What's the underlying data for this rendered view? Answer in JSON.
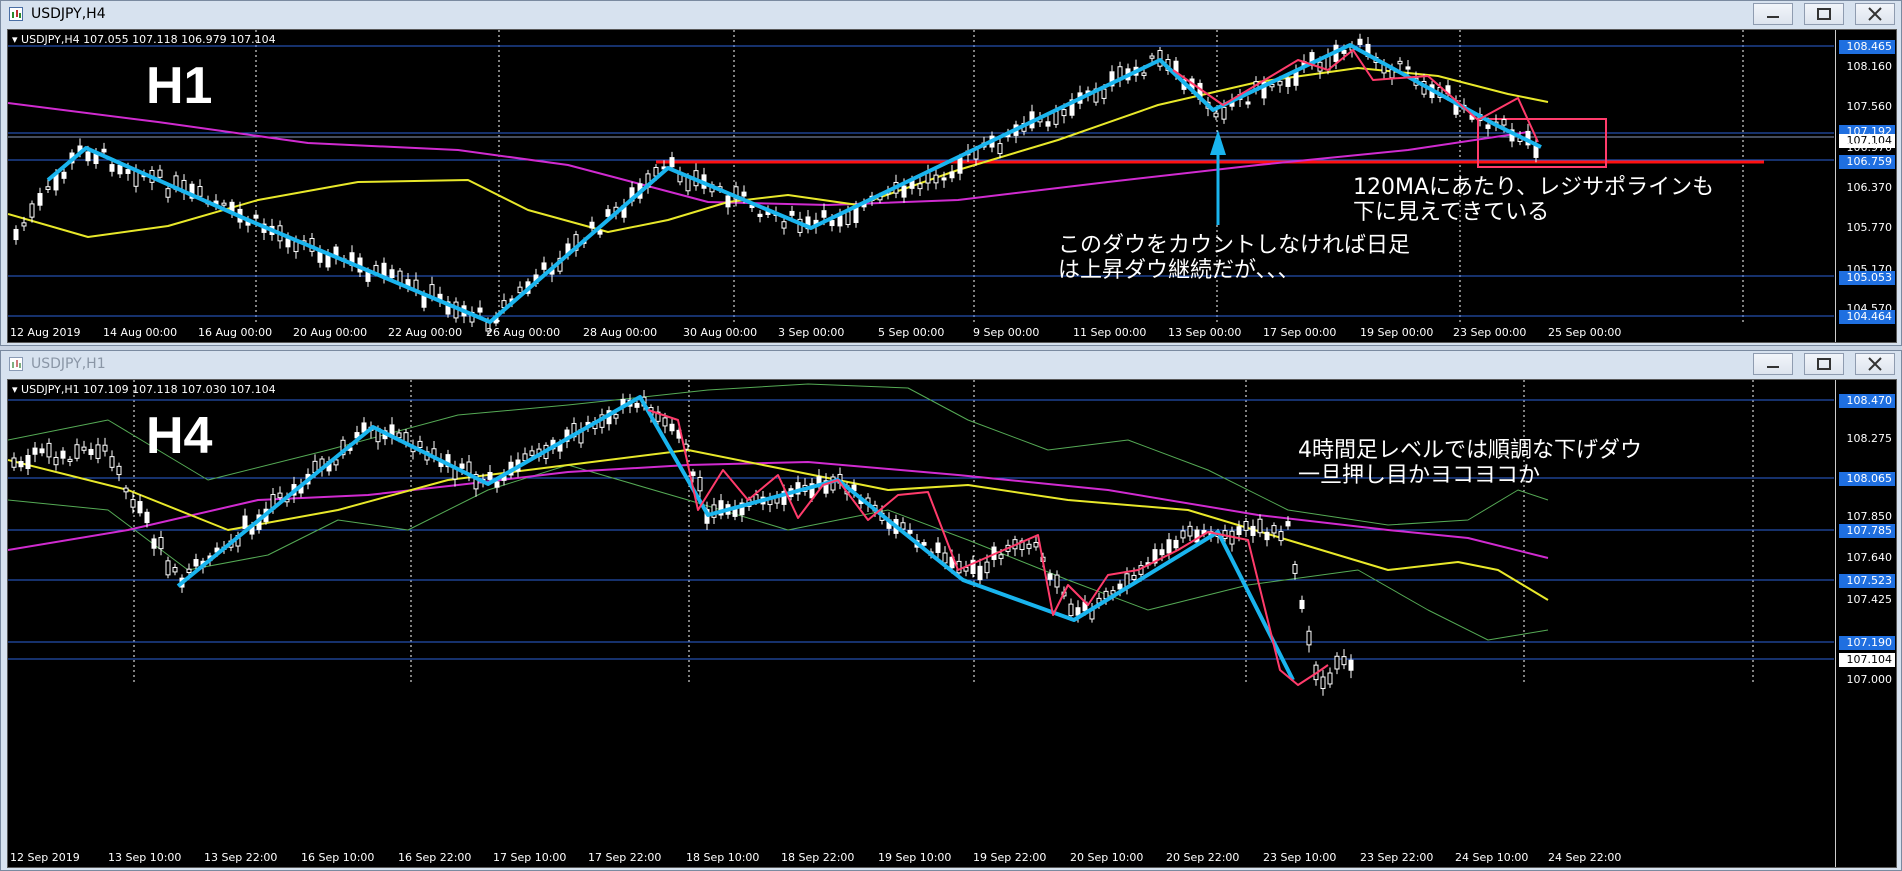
{
  "top_window": {
    "title": "USDJPY,H4",
    "header": "USDJPY,H4  107.055 107.118 106.979 107.104",
    "big_label": "H1",
    "annotation_right": "120MAにあたり、レジサポラインも\n下に見えてきている",
    "annotation_center": "このダウをカウントしなければ日足\nは上昇ダウ継続だが、、、",
    "price_ticks": [
      "108.160",
      "107.560",
      "106.970",
      "106.370",
      "105.770",
      "105.170",
      "104.570"
    ],
    "price_tags": [
      {
        "label": "108.465",
        "bg": "#1f6fe0"
      },
      {
        "label": "107.192",
        "bg": "#1f6fe0"
      },
      {
        "label": "107.104",
        "bg": "#ffffff"
      },
      {
        "label": "106.759",
        "bg": "#1f6fe0"
      },
      {
        "label": "105.053",
        "bg": "#1f6fe0"
      },
      {
        "label": "104.464",
        "bg": "#1f6fe0"
      }
    ],
    "time_labels": [
      "12 Aug 2019",
      "14 Aug 00:00",
      "16 Aug 00:00",
      "20 Aug 00:00",
      "22 Aug 00:00",
      "26 Aug 00:00",
      "28 Aug 00:00",
      "30 Aug 00:00",
      "3 Sep 00:00",
      "5 Sep 00:00",
      "9 Sep 00:00",
      "11 Sep 00:00",
      "13 Sep 00:00",
      "17 Sep 00:00",
      "19 Sep 00:00",
      "23 Sep 00:00",
      "25 Sep 00:00"
    ]
  },
  "bottom_window": {
    "title": "USDJPY,H1",
    "header": "USDJPY,H1  107.109 107.118 107.030 107.104",
    "big_label": "H4",
    "annotation": "4時間足レベルでは順調な下げダウ\n一旦押し目かヨコヨコか",
    "price_ticks": [
      "108.275",
      "107.850",
      "107.640",
      "107.425",
      "107.000"
    ],
    "price_tags": [
      {
        "label": "108.470",
        "bg": "#1f6fe0"
      },
      {
        "label": "108.065",
        "bg": "#1f6fe0"
      },
      {
        "label": "107.785",
        "bg": "#1f6fe0"
      },
      {
        "label": "107.523",
        "bg": "#1f6fe0"
      },
      {
        "label": "107.190",
        "bg": "#1f6fe0"
      },
      {
        "label": "107.104",
        "bg": "#ffffff"
      }
    ],
    "time_labels": [
      "12 Sep 2019",
      "13 Sep 10:00",
      "13 Sep 22:00",
      "16 Sep 10:00",
      "16 Sep 22:00",
      "17 Sep 10:00",
      "17 Sep 22:00",
      "18 Sep 10:00",
      "18 Sep 22:00",
      "19 Sep 10:00",
      "19 Sep 22:00",
      "20 Sep 10:00",
      "20 Sep 22:00",
      "23 Sep 10:00",
      "23 Sep 22:00",
      "24 Sep 10:00",
      "24 Sep 22:00"
    ]
  },
  "colors": {
    "accent": "#1f6fe0",
    "cyan": "#19b4ee",
    "pink": "#ff3b6b",
    "magenta": "#d02bd0",
    "yellow": "#e8e82a",
    "red": "#ff1010"
  }
}
